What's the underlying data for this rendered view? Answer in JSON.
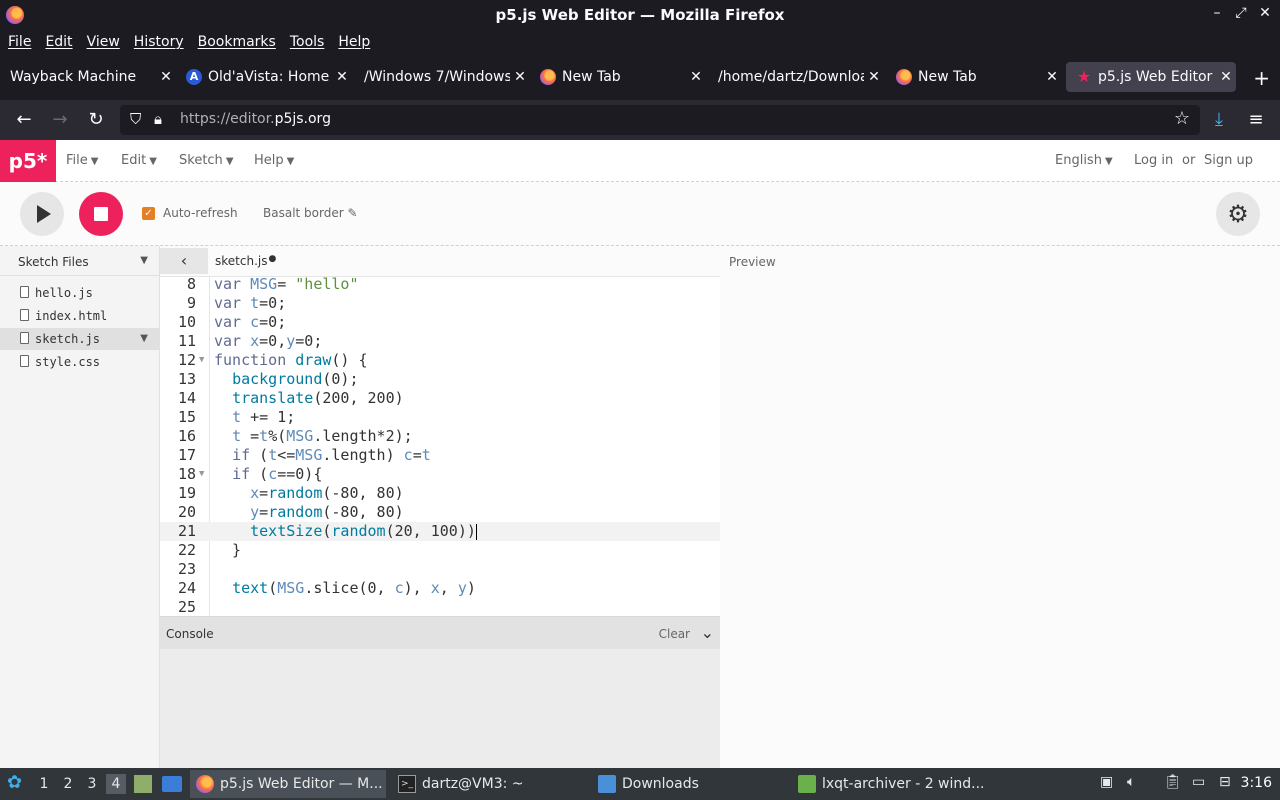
{
  "window": {
    "title": "p5.js Web Editor — Mozilla Firefox",
    "controls": [
      "–",
      "⤢",
      "✕"
    ]
  },
  "menubar": [
    "File",
    "Edit",
    "View",
    "History",
    "Bookmarks",
    "Tools",
    "Help"
  ],
  "tabs": [
    {
      "label": "Wayback Machine",
      "icon": "none"
    },
    {
      "label": "Old'aVista: Home",
      "icon": "altavista-icon"
    },
    {
      "label": "/Windows 7/Windows",
      "icon": "none"
    },
    {
      "label": "New Tab",
      "icon": "firefox-icon"
    },
    {
      "label": "/home/dartz/Downloads",
      "icon": "none"
    },
    {
      "label": "New Tab",
      "icon": "firefox-icon"
    },
    {
      "label": "p5.js Web Editor",
      "icon": "p5-star-icon",
      "active": true
    }
  ],
  "nav": {
    "url_prefix": "https://editor.",
    "url_domain": "p5js.org"
  },
  "p5": {
    "logo": "p5*",
    "menus": [
      "File",
      "Edit",
      "Sketch",
      "Help"
    ],
    "language": "English",
    "login": "Log in",
    "or": "or",
    "signup": "Sign up",
    "auto_refresh": "Auto-refresh",
    "sketch_name": "Basalt border ✎",
    "sidebar_title": "Sketch Files",
    "files": [
      "hello.js",
      "index.html",
      "sketch.js",
      "style.css"
    ],
    "selected_file": "sketch.js",
    "editor_tab": "sketch.js",
    "preview_label": "Preview",
    "console_label": "Console",
    "console_clear": "Clear"
  },
  "code_lines": [
    {
      "n": "8",
      "text": "var MSG= \"hello\""
    },
    {
      "n": "9",
      "text": "var t=0;"
    },
    {
      "n": "10",
      "text": "var c=0;"
    },
    {
      "n": "11",
      "text": "var x=0,y=0;"
    },
    {
      "n": "12",
      "text": "function draw() {",
      "fold": true
    },
    {
      "n": "13",
      "text": "  background(0);"
    },
    {
      "n": "14",
      "text": "  translate(200, 200)"
    },
    {
      "n": "15",
      "text": "  t += 1;"
    },
    {
      "n": "16",
      "text": "  t =t%(MSG.length*2);"
    },
    {
      "n": "17",
      "text": "  if (t<=MSG.length) c=t"
    },
    {
      "n": "18",
      "text": "  if (c==0){",
      "fold": true
    },
    {
      "n": "19",
      "text": "    x=random(-80, 80)"
    },
    {
      "n": "20",
      "text": "    y=random(-80, 80)"
    },
    {
      "n": "21",
      "text": "    textSize(random(20, 100))",
      "current": true
    },
    {
      "n": "22",
      "text": "  }"
    },
    {
      "n": "23",
      "text": ""
    },
    {
      "n": "24",
      "text": "  text(MSG.slice(0, c), x, y)"
    },
    {
      "n": "25",
      "text": ""
    }
  ],
  "taskbar": {
    "workspaces": [
      "1",
      "2",
      "3",
      "4"
    ],
    "active_workspace": "4",
    "windows": [
      {
        "label": "p5.js Web Editor — M...",
        "icon": "firefox-icon",
        "active": true
      },
      {
        "label": "dartz@VM3: ~",
        "icon": "terminal-icon"
      },
      {
        "label": "Downloads",
        "icon": "folder-icon"
      },
      {
        "label": "lxqt-archiver - 2 wind...",
        "icon": "archiver-icon"
      }
    ],
    "clock": "3:16"
  }
}
